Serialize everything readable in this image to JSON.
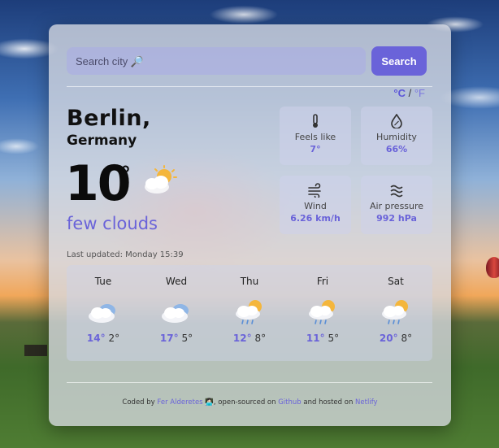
{
  "search": {
    "placeholder": "Search city 🔎",
    "button_label": "Search"
  },
  "units": {
    "celsius": "°C",
    "separator": "/",
    "fahrenheit": "°F"
  },
  "current": {
    "city": "Berlin,",
    "country": "Germany",
    "temperature": "10",
    "degree_symbol": "°",
    "icon": "few-clouds-day-icon",
    "description": "few clouds",
    "last_updated": "Last updated: Monday 15:39"
  },
  "stats": [
    {
      "label": "Feels like",
      "value": "7°",
      "icon": "thermometer-icon"
    },
    {
      "label": "Humidity",
      "value": "66%",
      "icon": "humidity-drop-icon"
    },
    {
      "label": "Wind",
      "value": "6.26 km/h",
      "icon": "wind-icon"
    },
    {
      "label": "Air pressure",
      "value": "992 hPa",
      "icon": "air-pressure-icon"
    }
  ],
  "forecast": [
    {
      "day": "Tue",
      "high": "14°",
      "low": "2°",
      "icon": "cloudy-icon"
    },
    {
      "day": "Wed",
      "high": "17°",
      "low": "5°",
      "icon": "cloudy-icon"
    },
    {
      "day": "Thu",
      "high": "12°",
      "low": "8°",
      "icon": "sun-rain-cloud-icon"
    },
    {
      "day": "Fri",
      "high": "11°",
      "low": "5°",
      "icon": "sun-rain-cloud-icon"
    },
    {
      "day": "Sat",
      "high": "20°",
      "low": "8°",
      "icon": "sun-rain-cloud-icon"
    }
  ],
  "footer": {
    "prefix": "Coded by",
    "author": "Fer Alderetes",
    "emoji": "👩🏻‍💻",
    "middle": ", open-sourced on",
    "repo": "Github",
    "hosted": "and hosted on",
    "host": "Netlify"
  },
  "colors": {
    "accent": "#6a63d9",
    "card_bg": "#d7dae2"
  }
}
